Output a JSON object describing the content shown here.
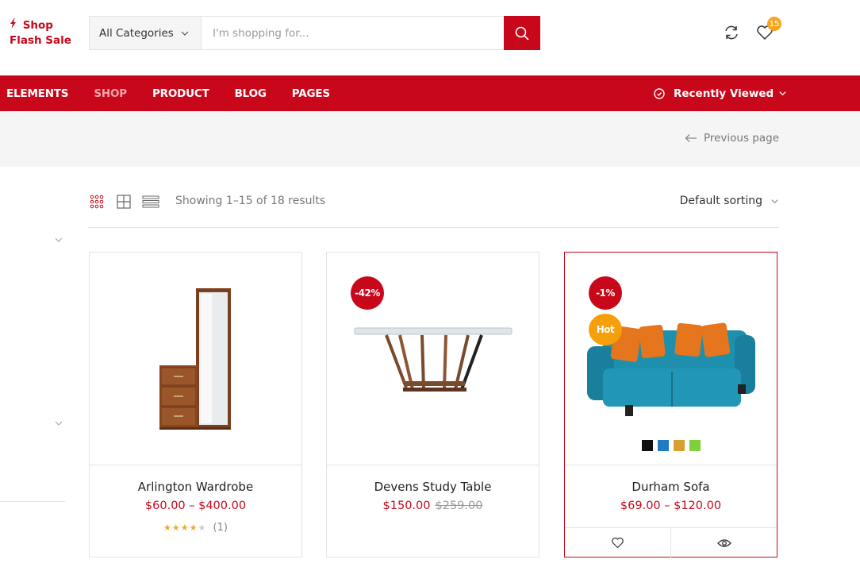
{
  "header": {
    "flash_line1": "Shop",
    "flash_line2": "Flash Sale",
    "category_select": "All Categories",
    "search_placeholder": "I'm shopping for...",
    "wishlist_count": "15"
  },
  "nav": {
    "items": [
      "ELEMENTS",
      "SHOP",
      "PRODUCT",
      "BLOG",
      "PAGES"
    ],
    "recently_viewed": "Recently Viewed"
  },
  "breadcrumb": {
    "previous_page": "Previous page"
  },
  "toolbar": {
    "result_count": "Showing 1–15 of 18 results",
    "sorting": "Default sorting"
  },
  "products": [
    {
      "name": "Arlington Wardrobe",
      "price": "$60.00 – $400.00",
      "rating_count": "(1)",
      "rating": 4
    },
    {
      "name": "Devens Study Table",
      "price": "$150.00",
      "old_price": "$259.00",
      "badge": "-42%"
    },
    {
      "name": "Durham Sofa",
      "price": "$69.00 – $120.00",
      "badge": "-1%",
      "badge2": "Hot",
      "swatches": [
        "#111111",
        "#1f7bc4",
        "#d9a030",
        "#7fd13b"
      ]
    }
  ],
  "colors": {
    "accent": "#c8081a",
    "hot": "#f59f0a",
    "badge": "#f5a623"
  }
}
